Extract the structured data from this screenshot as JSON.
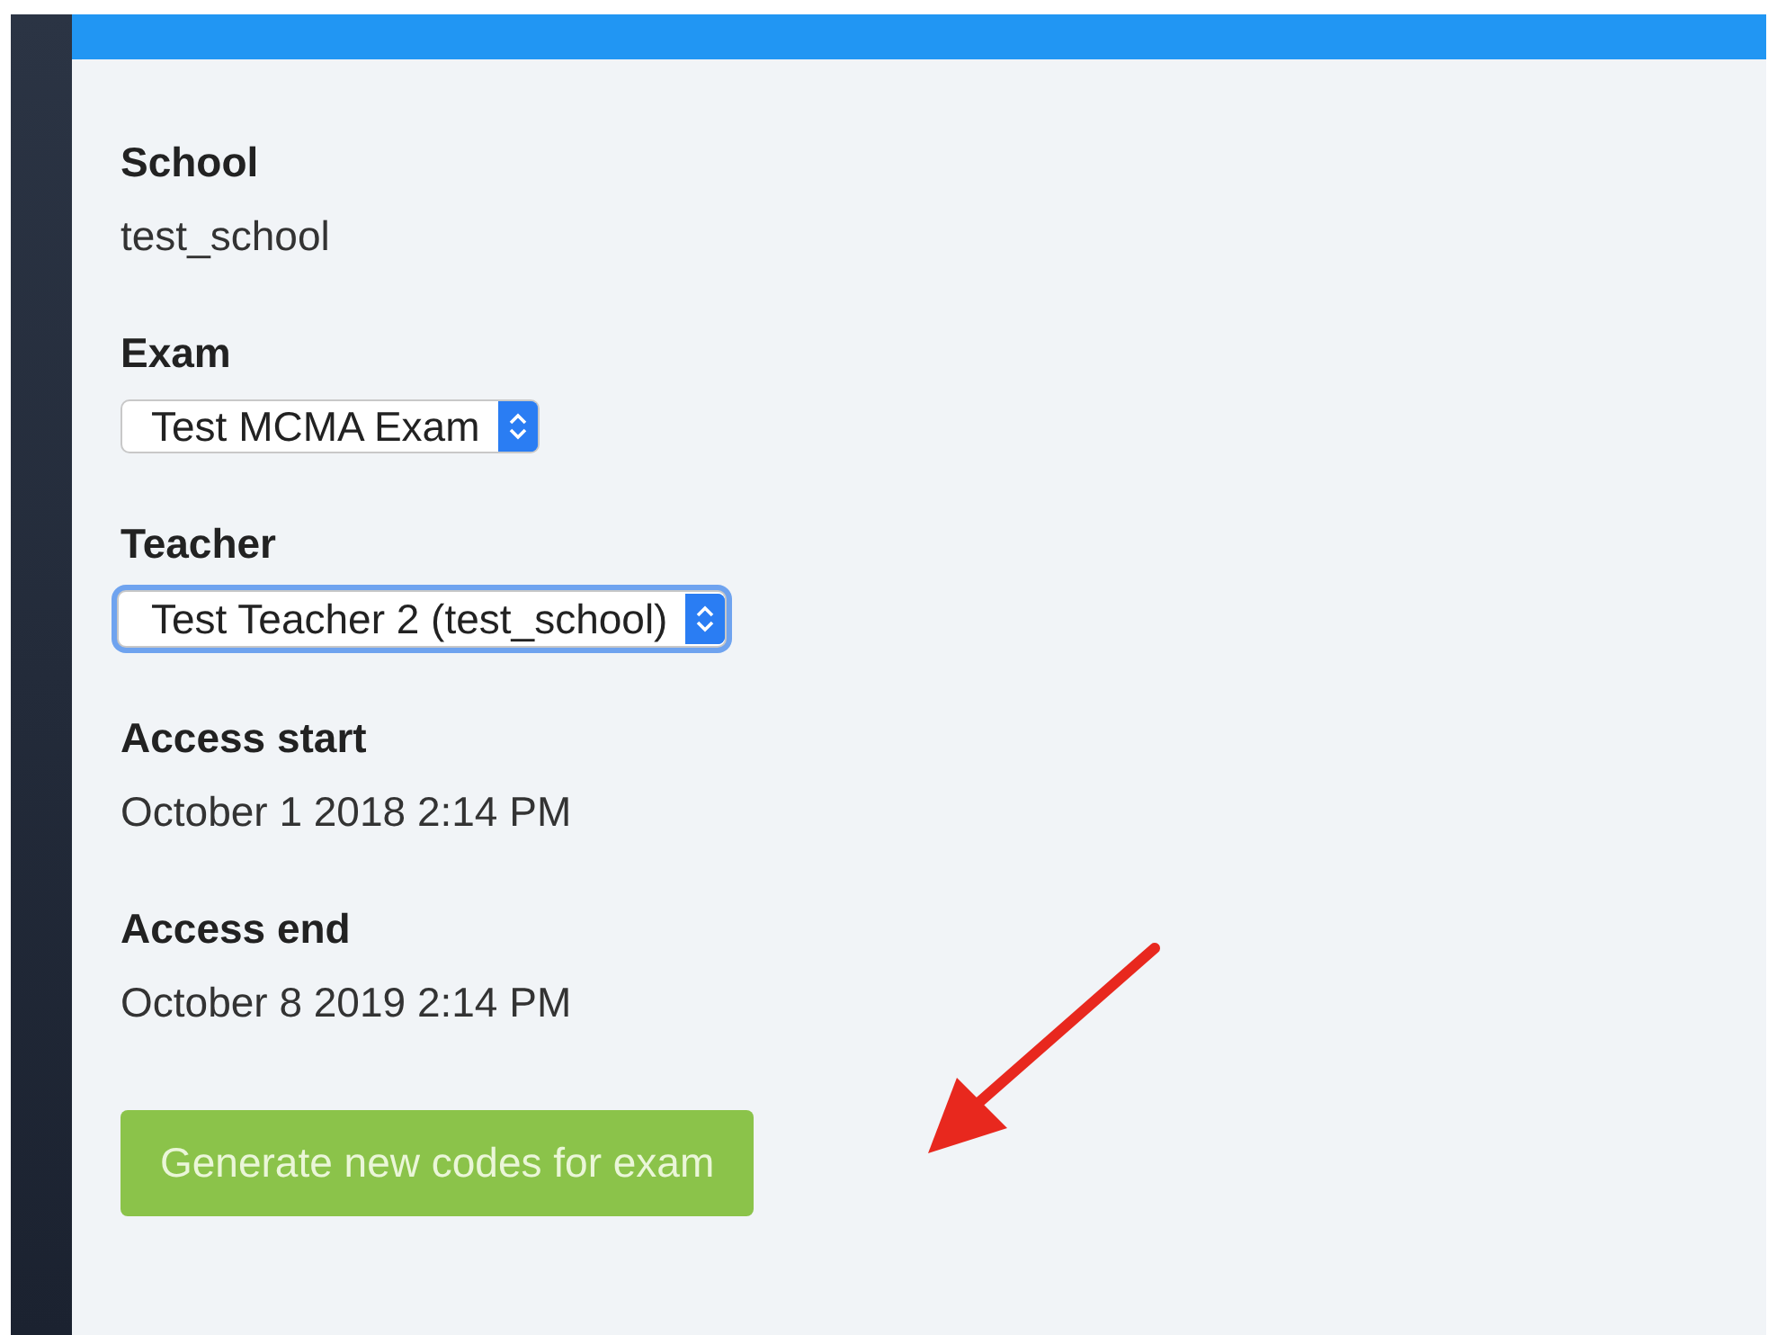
{
  "fields": [
    {
      "kind": "text",
      "label": "School",
      "value": "test_school"
    },
    {
      "kind": "select",
      "label": "Exam",
      "value": "Test MCMA Exam",
      "focused": false
    },
    {
      "kind": "select",
      "label": "Teacher",
      "value": "Test Teacher 2 (test_school)",
      "focused": true
    },
    {
      "kind": "text",
      "label": "Access start",
      "value": "October 1 2018 2:14 PM"
    },
    {
      "kind": "text",
      "label": "Access end",
      "value": "October 8 2019 2:14 PM"
    }
  ],
  "button": {
    "label": "Generate new codes for exam"
  }
}
